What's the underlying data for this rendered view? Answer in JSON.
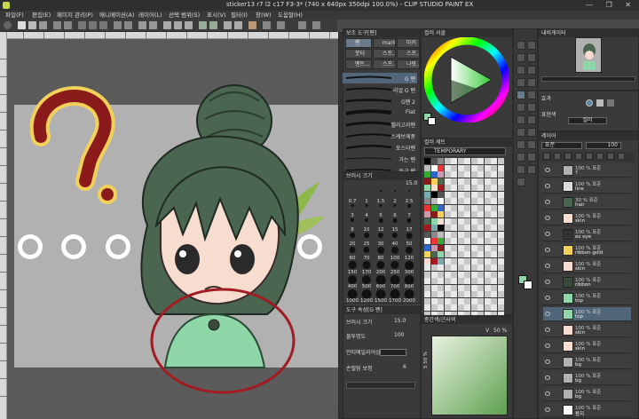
{
  "window": {
    "title": "sticker13 r7 l2 c17 F3-3* (740 x 640px 350dpi 100.0%) - CLIP STUDIO PAINT EX",
    "controls": "—  ❐  ✕"
  },
  "menu": [
    "파일(F)",
    "편집(E)",
    "페이지 관리(P)",
    "애니메이션(A)",
    "레이어(L)",
    "선택 범위(S)",
    "표시(V)",
    "필터(I)",
    "창(W)",
    "도움말(H)"
  ],
  "ruler": {
    "top": [
      "250",
      "0",
      "50",
      "100",
      "150",
      "200",
      "250",
      "300",
      "350",
      "400",
      "450",
      "500",
      "550",
      "600",
      "650",
      "700",
      "750"
    ],
    "left": [
      "400",
      "350",
      "300",
      "250",
      "200",
      "150",
      "100",
      "50",
      "0",
      "50",
      "100",
      "150",
      "200",
      "250",
      "300",
      "350",
      "400",
      "450",
      "500",
      "550",
      "600",
      "650"
    ]
  },
  "subtools": {
    "header": "보조 도구[펜]",
    "tabs": [
      "펜",
      "marker",
      "마커",
      "붓터",
      "스프...",
      "스프...",
      "멘트...",
      "스프...",
      "나팟..."
    ]
  },
  "brushes": [
    "G 펜",
    "리얼 G 펜",
    "G펜 2",
    "Flat",
    "멜리고리펜",
    "스케브에풍",
    "포스터펜",
    "가는 펜",
    "둥근 펜"
  ],
  "brush_size": {
    "header": "브러시 크기",
    "value": "15.0",
    "sizes": [
      "0.7",
      "1",
      "1.5",
      "2",
      "2.5",
      "3",
      "4",
      "5",
      "6",
      "7",
      "8",
      "10",
      "12",
      "15",
      "17",
      "20",
      "25",
      "30",
      "40",
      "50",
      "60",
      "70",
      "80",
      "100",
      "120",
      "150",
      "170",
      "200",
      "250",
      "300",
      "400",
      "500",
      "600",
      "700",
      "800",
      "1000",
      "1200",
      "1500",
      "1700",
      "2000"
    ]
  },
  "tool_property": {
    "header": "도구 속성[G 펜]",
    "rows": [
      {
        "label": "브러시 크기",
        "value": "15.0"
      },
      {
        "label": "불투명도",
        "value": "100"
      },
      {
        "label": "안티에일리어싱",
        "value": ""
      },
      {
        "label": "손떨림 보정",
        "value": "6"
      }
    ]
  },
  "color_wheel": {
    "header": "컬러 서클",
    "hsv": "H 122  S 35  V 72"
  },
  "color_set": {
    "header": "컬러 세트",
    "selector": "TEMPORARY"
  },
  "color_history": {
    "header": "중간색/근사색",
    "v_label": "V",
    "v_value": "50 %",
    "s_label": "S 50 %"
  },
  "navigator": {
    "header": "내비게이터"
  },
  "sub_view": {
    "effect_label": "효과",
    "mode_label": "표현색",
    "mode_value": "컬러"
  },
  "layers": {
    "header": "레이어",
    "blend": "표준",
    "opacity": "100",
    "rows": [
      {
        "opacity": "100 % 표준",
        "name": "?"
      },
      {
        "opacity": "100 % 표준",
        "name": "line"
      },
      {
        "opacity": "30 % 표준",
        "name": "hair"
      },
      {
        "opacity": "100 % 표준",
        "name": "skin"
      },
      {
        "opacity": "100 % 표준",
        "name": "ex eye"
      },
      {
        "opacity": "100 % 표준",
        "name": "ribbon gold"
      },
      {
        "opacity": "100 % 표준",
        "name": "skin"
      },
      {
        "opacity": "100 % 표준",
        "name": "ribbon"
      },
      {
        "opacity": "100 % 표준",
        "name": "top"
      },
      {
        "opacity": "100 % 표준",
        "name": "top"
      },
      {
        "opacity": "100 % 표준",
        "name": "skin"
      },
      {
        "opacity": "100 % 표준",
        "name": "skin"
      },
      {
        "opacity": "100 % 표준",
        "name": "bg"
      },
      {
        "opacity": "100 % 표준",
        "name": "bg"
      },
      {
        "opacity": "100 % 표준",
        "name": "bg"
      },
      {
        "opacity": "100 % 표준",
        "name": "용지"
      }
    ]
  },
  "colors": {
    "question_mark": "#8b1a1a",
    "question_outline": "#f2d15a",
    "hair": "#4a6650",
    "circle": "#a01c22",
    "shirt": "#8fd7a8"
  }
}
